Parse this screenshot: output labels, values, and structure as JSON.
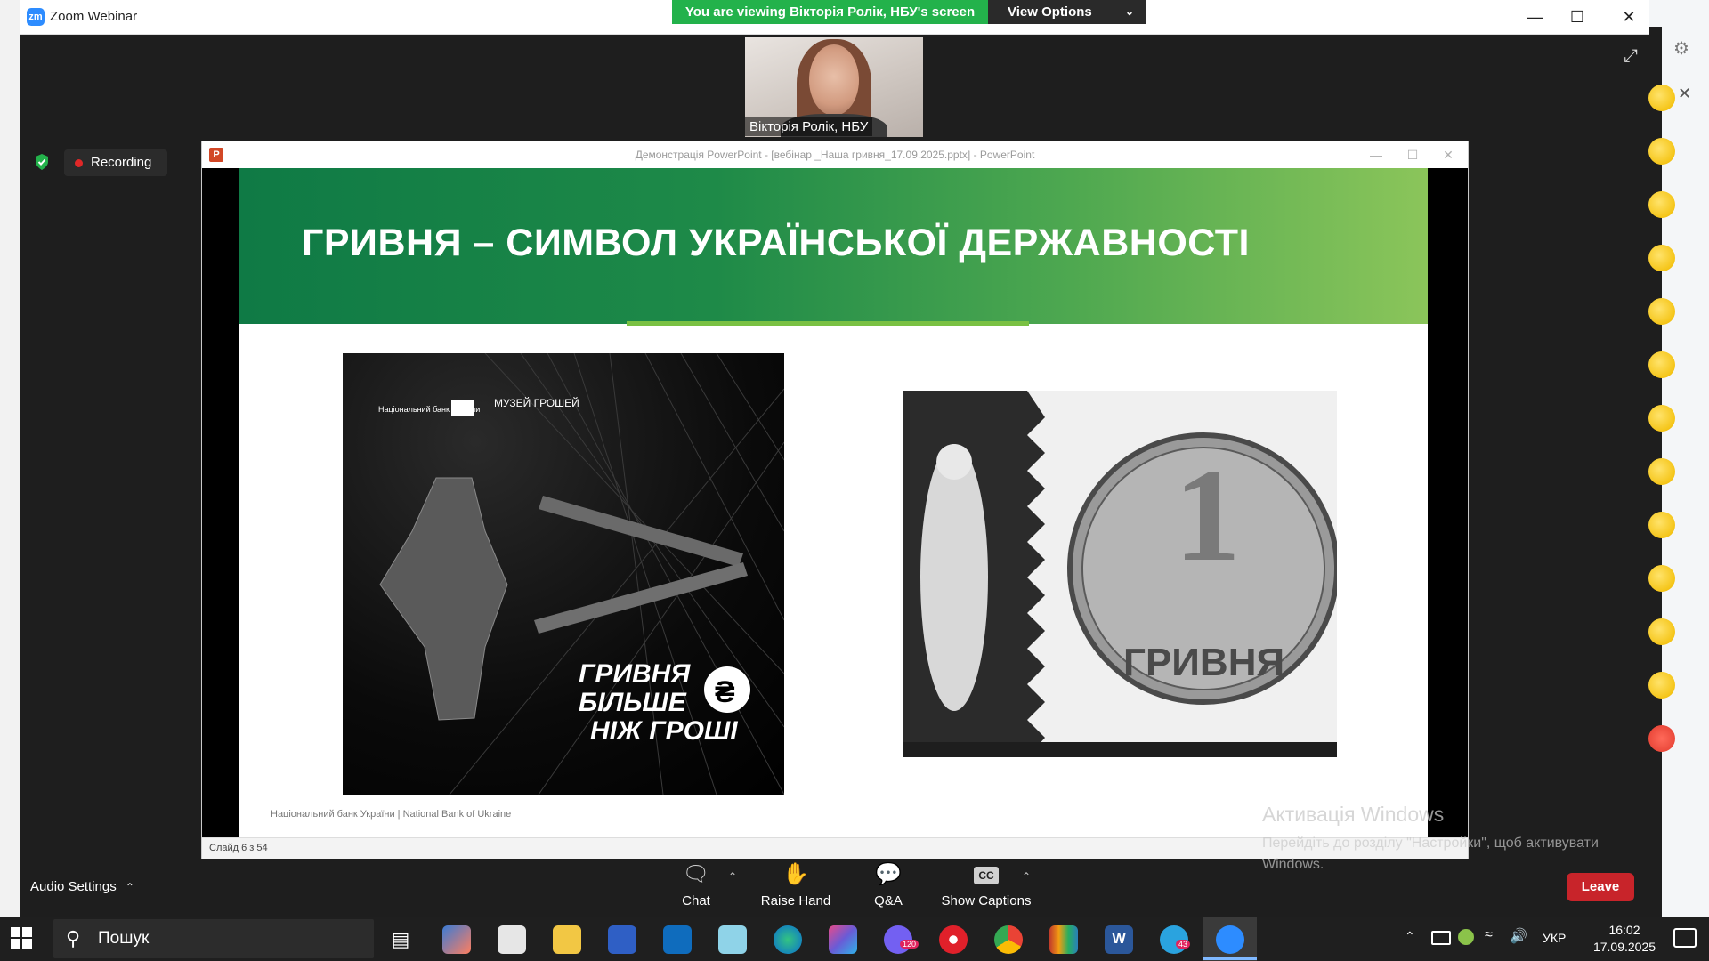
{
  "app": {
    "title": "Zoom Webinar",
    "logo_text": "zm"
  },
  "banner": {
    "viewing": "You are viewing Вікторія Ролік, НБУ's screen",
    "view_options": "View Options"
  },
  "video": {
    "participant_name": "Вікторія Ролік, НБУ"
  },
  "recording": {
    "label": "Recording"
  },
  "powerpoint": {
    "title": "Демонстрація PowerPoint - [вебінар _Наша гривня_17.09.2025.pptx] - PowerPoint",
    "slide_counter": "Слайд 6 з 54"
  },
  "slide": {
    "title": "ГРИВНЯ – СИМВОЛ УКРАЇНСЬКОЇ ДЕРЖАВНОСТІ",
    "footer": "Національний банк України | National Bank of Ukraine",
    "poster": {
      "logo1": "Національний банк України",
      "logo2": "МУЗЕЙ ГРОШЕЙ",
      "line1": "ГРИВНЯ",
      "line2": "БІЛЬШЕ",
      "line3": "НІЖ ГРОШІ",
      "currency_sign": "₴"
    },
    "coin": {
      "denomination": "1",
      "word": "ГРИВНЯ"
    }
  },
  "activation": {
    "title": "Активація Windows",
    "subtitle": "Перейдіть до розділу \"Настройки\", щоб активувати Windows."
  },
  "toolbar": {
    "audio_settings": "Audio Settings",
    "chat": "Chat",
    "raise_hand": "Raise Hand",
    "qa": "Q&A",
    "captions": "Show Captions",
    "captions_icon_text": "CC",
    "leave": "Leave"
  },
  "taskbar": {
    "search_placeholder": "Пошук",
    "language": "УКР",
    "time": "16:02",
    "date": "17.09.2025",
    "badges": {
      "viber": "120",
      "telegram": "43"
    }
  },
  "colors": {
    "zoom_blue": "#2d8cff",
    "banner_green": "#23b24b",
    "leave_red": "#c8242a",
    "slide_green_start": "#0f7a45",
    "slide_green_end": "#8bc55a"
  },
  "icons": [
    "zoom-logo-icon",
    "minimize-icon",
    "maximize-icon",
    "close-icon",
    "expand-icon",
    "shield-icon",
    "chat-icon",
    "raise-hand-icon",
    "qa-icon",
    "cc-icon",
    "windows-start-icon",
    "search-icon"
  ]
}
